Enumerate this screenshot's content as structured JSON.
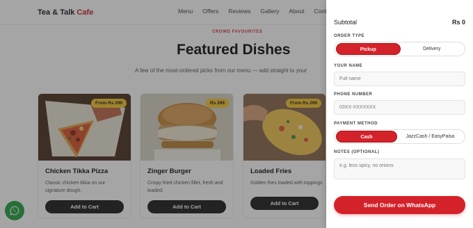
{
  "brand": {
    "name": "Tea & Talk",
    "accent": "Cafe",
    "accent_color": "#c4252d"
  },
  "nav": {
    "items": [
      "Menu",
      "Offers",
      "Reviews",
      "Gallery",
      "About",
      "Contact"
    ]
  },
  "section": {
    "eyebrow": "CROWD FAVOURITES",
    "title": "Featured Dishes",
    "subtitle": "A few of the most-ordered picks from our menu — add straight to your"
  },
  "cards": [
    {
      "price": "From Rs 299",
      "title": "Chicken Tikka Pizza",
      "desc": "Classic chicken tikka on our signature dough.",
      "button": "Add to Cart"
    },
    {
      "price": "Rs 299",
      "title": "Zinger Burger",
      "desc": "Crispy fried chicken fillet, fresh and loaded.",
      "button": "Add to Cart"
    },
    {
      "price": "From Rs 299",
      "title": "Loaded Fries",
      "desc": "Golden fries loaded with toppings",
      "button": "Add to Cart"
    }
  ],
  "drawer": {
    "subtotal_label": "Subtotal",
    "subtotal_value": "Rs 0",
    "order_type_label": "ORDER TYPE",
    "order_types": [
      "Pickup",
      "Delivery"
    ],
    "name_label": "YOUR NAME",
    "name_placeholder": "Full name",
    "phone_label": "PHONE NUMBER",
    "phone_placeholder": "03XX-XXXXXXX",
    "payment_label": "PAYMENT METHOD",
    "payments": [
      "Cash",
      "JazzCash / EasyPaisa"
    ],
    "notes_label": "NOTES (OPTIONAL)",
    "notes_placeholder": "e.g. less spicy, no onions",
    "send_button": "Send Order on WhatsApp"
  },
  "colors": {
    "primary": "#d3222a",
    "price_badge": "#f4c531",
    "whatsapp": "#25a244"
  },
  "icons": {
    "floating": "whatsapp-icon"
  }
}
